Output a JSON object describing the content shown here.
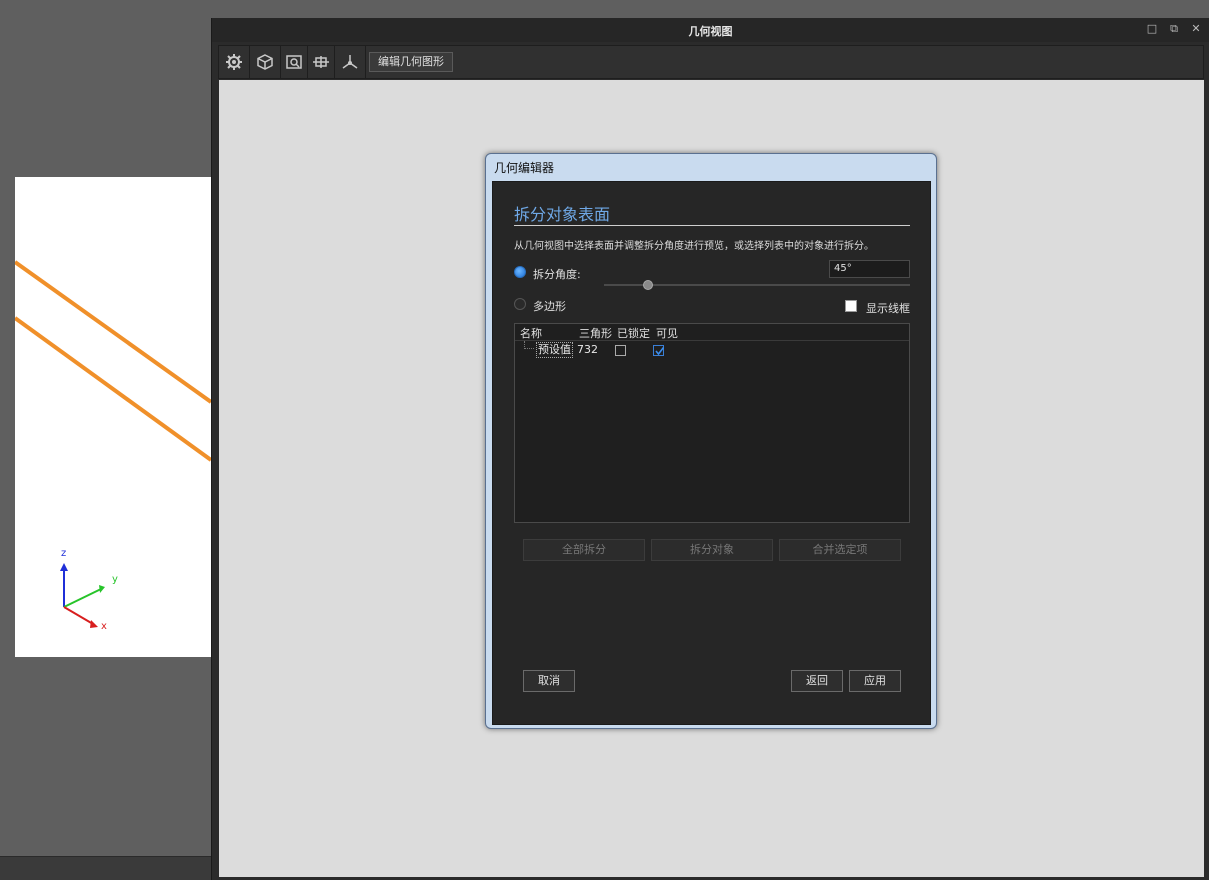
{
  "window": {
    "title": "几何视图",
    "controls": {
      "maximize": "□",
      "restore": "⧉",
      "close": "✕"
    }
  },
  "toolbar": {
    "edit_geometry_label": "编辑几何图形",
    "icons": [
      "gear-icon",
      "cube-icon",
      "camera-icon",
      "transform-icon",
      "axis-icon"
    ]
  },
  "viewport": {
    "axis_labels": {
      "z": "z",
      "y": "y",
      "x": "x"
    },
    "colors": {
      "lines": "#f0902a",
      "z": "#1f2fd8",
      "y": "#27c42a",
      "x": "#d81e1e"
    }
  },
  "dialog": {
    "title": "几何编辑器",
    "section_title": "拆分对象表面",
    "description": "从几何视图中选择表面并调整拆分角度进行预览，或选择列表中的对象进行拆分。",
    "split_angle_label": "拆分角度:",
    "split_angle_value": "45°",
    "split_angle_selected": true,
    "polygon_label": "多边形",
    "show_wireframe_label": "显示线框",
    "show_wireframe_checked": false,
    "table": {
      "headers": [
        "名称",
        "三角形",
        "已锁定",
        "可见"
      ],
      "rows": [
        {
          "name": "预设值",
          "triangles": "732",
          "locked": false,
          "visible": true
        }
      ]
    },
    "buttons": {
      "split_all": "全部拆分",
      "split_object": "拆分对象",
      "merge_selected": "合并选定项",
      "cancel": "取消",
      "back": "返回",
      "apply": "应用"
    }
  }
}
